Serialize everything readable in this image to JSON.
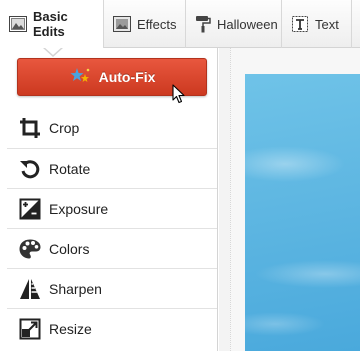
{
  "tabs": [
    {
      "label": "Basic Edits",
      "icon": "image-icon",
      "active": true
    },
    {
      "label": "Effects",
      "icon": "picture-frame-icon",
      "active": false
    },
    {
      "label": "Halloween",
      "icon": "paint-roller-icon",
      "active": false
    },
    {
      "label": "Text",
      "icon": "text-box-icon",
      "active": false
    }
  ],
  "autofix": {
    "label": "Auto-Fix",
    "icon": "sparkle-stars-icon",
    "color": "#d9432a"
  },
  "tools": [
    {
      "label": "Crop",
      "icon": "crop-icon"
    },
    {
      "label": "Rotate",
      "icon": "rotate-icon"
    },
    {
      "label": "Exposure",
      "icon": "exposure-icon"
    },
    {
      "label": "Colors",
      "icon": "palette-icon"
    },
    {
      "label": "Sharpen",
      "icon": "sharpen-icon"
    },
    {
      "label": "Resize",
      "icon": "resize-icon"
    }
  ]
}
